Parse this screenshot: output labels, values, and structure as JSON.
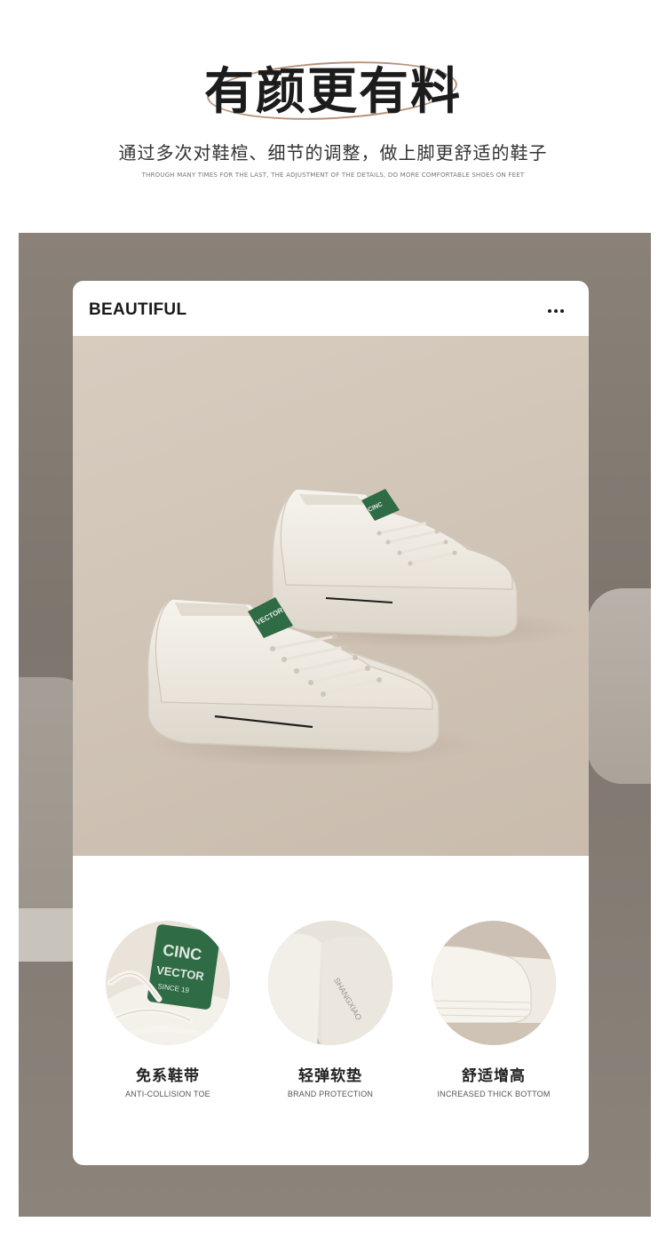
{
  "header": {
    "title": "有颜更有料",
    "subtitle": "通过多次对鞋楦、细节的调整，做上脚更舒适的鞋子",
    "subtitle_en": "THROUGH MANY TIMES FOR THE LAST, THE ADJUSTMENT OF THE DETAILS, DO MORE COMFORTABLE SHOES ON FEET"
  },
  "card": {
    "title": "BEAUTIFUL",
    "more_icon": "more-horizontal-icon"
  },
  "product": {
    "tongue_label_line1": "CINC",
    "tongue_label_line2": "VECTOR"
  },
  "features": [
    {
      "name": "免系鞋带",
      "name_en": "ANTI-COLLISION TOE",
      "detail_text_1": "CINC",
      "detail_text_2": "VECTOR",
      "detail_text_3": "SINCE 19"
    },
    {
      "name": "轻弹软垫",
      "name_en": "BRAND PROTECTION",
      "detail_text_1": "SHANGXIAO"
    },
    {
      "name": "舒适增高",
      "name_en": "INCREASED THICK BOTTOM"
    }
  ],
  "colors": {
    "panel": "#857c73",
    "accent_green": "#2f6b45",
    "ellipse": "#b6927a",
    "hero_bg": "#d3c7b9"
  }
}
